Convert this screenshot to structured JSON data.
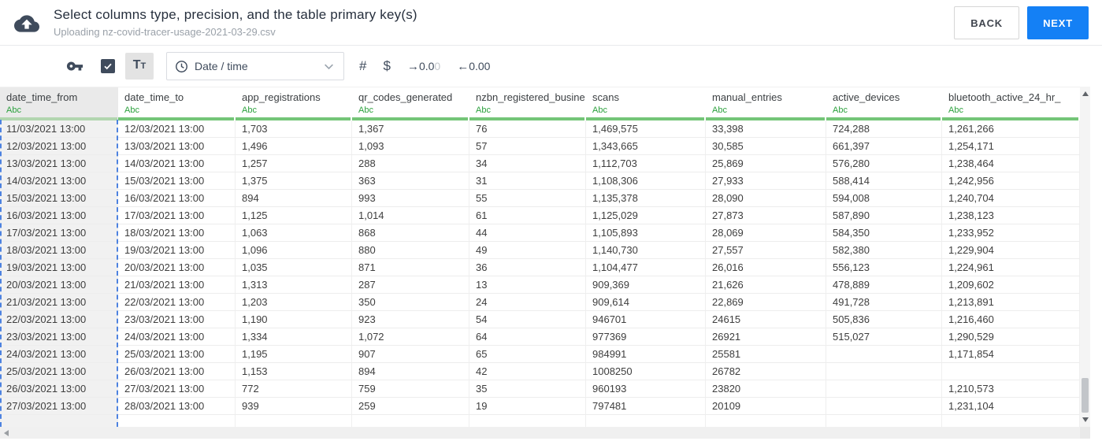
{
  "header": {
    "title": "Select columns type, precision, and the table primary key(s)",
    "subtitle": "Uploading nz-covid-tracer-usage-2021-03-29.csv",
    "back_label": "BACK",
    "next_label": "NEXT"
  },
  "toolbar": {
    "type_toggle": {
      "large": "T",
      "small": "T"
    },
    "type_select_value": "Date / time",
    "number_symbol": "#",
    "currency_symbol": "$",
    "precision_increase": {
      "arrow": "→",
      "value": "0.0",
      "faded": "0"
    },
    "precision_decrease": {
      "arrow": "←",
      "value": "0.00"
    }
  },
  "table": {
    "selected_column_index": 0,
    "columns": [
      {
        "name": "date_time_from",
        "type": "Abc"
      },
      {
        "name": "date_time_to",
        "type": "Abc"
      },
      {
        "name": "app_registrations",
        "type": "Abc"
      },
      {
        "name": "qr_codes_generated",
        "type": "Abc"
      },
      {
        "name": "nzbn_registered_busine",
        "type": "Abc"
      },
      {
        "name": "scans",
        "type": "Abc"
      },
      {
        "name": "manual_entries",
        "type": "Abc"
      },
      {
        "name": "active_devices",
        "type": "Abc"
      },
      {
        "name": "bluetooth_active_24_hr_",
        "type": "Abc"
      }
    ],
    "rows": [
      [
        "11/03/2021 13:00",
        "12/03/2021 13:00",
        "1,703",
        "1,367",
        "76",
        "1,469,575",
        "33,398",
        "724,288",
        "1,261,266"
      ],
      [
        "12/03/2021 13:00",
        "13/03/2021 13:00",
        "1,496",
        "1,093",
        "57",
        "1,343,665",
        "30,585",
        "661,397",
        "1,254,171"
      ],
      [
        "13/03/2021 13:00",
        "14/03/2021 13:00",
        "1,257",
        "288",
        "34",
        "1,112,703",
        "25,869",
        "576,280",
        "1,238,464"
      ],
      [
        "14/03/2021 13:00",
        "15/03/2021 13:00",
        "1,375",
        "363",
        "31",
        "1,108,306",
        "27,933",
        "588,414",
        "1,242,956"
      ],
      [
        "15/03/2021 13:00",
        "16/03/2021 13:00",
        "894",
        "993",
        "55",
        "1,135,378",
        "28,090",
        "594,008",
        "1,240,704"
      ],
      [
        "16/03/2021 13:00",
        "17/03/2021 13:00",
        "1,125",
        "1,014",
        "61",
        "1,125,029",
        "27,873",
        "587,890",
        "1,238,123"
      ],
      [
        "17/03/2021 13:00",
        "18/03/2021 13:00",
        "1,063",
        "868",
        "44",
        "1,105,893",
        "28,069",
        "584,350",
        "1,233,952"
      ],
      [
        "18/03/2021 13:00",
        "19/03/2021 13:00",
        "1,096",
        "880",
        "49",
        "1,140,730",
        "27,557",
        "582,380",
        "1,229,904"
      ],
      [
        "19/03/2021 13:00",
        "20/03/2021 13:00",
        "1,035",
        "871",
        "36",
        "1,104,477",
        "26,016",
        "556,123",
        "1,224,961"
      ],
      [
        "20/03/2021 13:00",
        "21/03/2021 13:00",
        "1,313",
        "287",
        "13",
        "909,369",
        "21,626",
        "478,889",
        "1,209,602"
      ],
      [
        "21/03/2021 13:00",
        "22/03/2021 13:00",
        "1,203",
        "350",
        "24",
        "909,614",
        "22,869",
        "491,728",
        "1,213,891"
      ],
      [
        "22/03/2021 13:00",
        "23/03/2021 13:00",
        "1,190",
        "923",
        "54",
        "946701",
        "24615",
        "505,836",
        "1,216,460"
      ],
      [
        "23/03/2021 13:00",
        "24/03/2021 13:00",
        "1,334",
        "1,072",
        "64",
        "977369",
        "26921",
        "515,027",
        "1,290,529"
      ],
      [
        "24/03/2021 13:00",
        "25/03/2021 13:00",
        "1,195",
        "907",
        "65",
        "984991",
        "25581",
        "",
        "1,171,854"
      ],
      [
        "25/03/2021 13:00",
        "26/03/2021 13:00",
        "1,153",
        "894",
        "42",
        "1008250",
        "26782",
        "",
        ""
      ],
      [
        "26/03/2021 13:00",
        "27/03/2021 13:00",
        "772",
        "759",
        "35",
        "960193",
        "23820",
        "",
        "1,210,573"
      ],
      [
        "27/03/2021 13:00",
        "28/03/2021 13:00",
        "939",
        "259",
        "19",
        "797481",
        "20109",
        "",
        "1,231,104"
      ]
    ]
  },
  "colors": {
    "next_button_blue": "#1480f5",
    "type_badge_green": "#2aa03c",
    "column_bar_green": "#74c578",
    "selection_dash_blue": "#4d82e0"
  }
}
